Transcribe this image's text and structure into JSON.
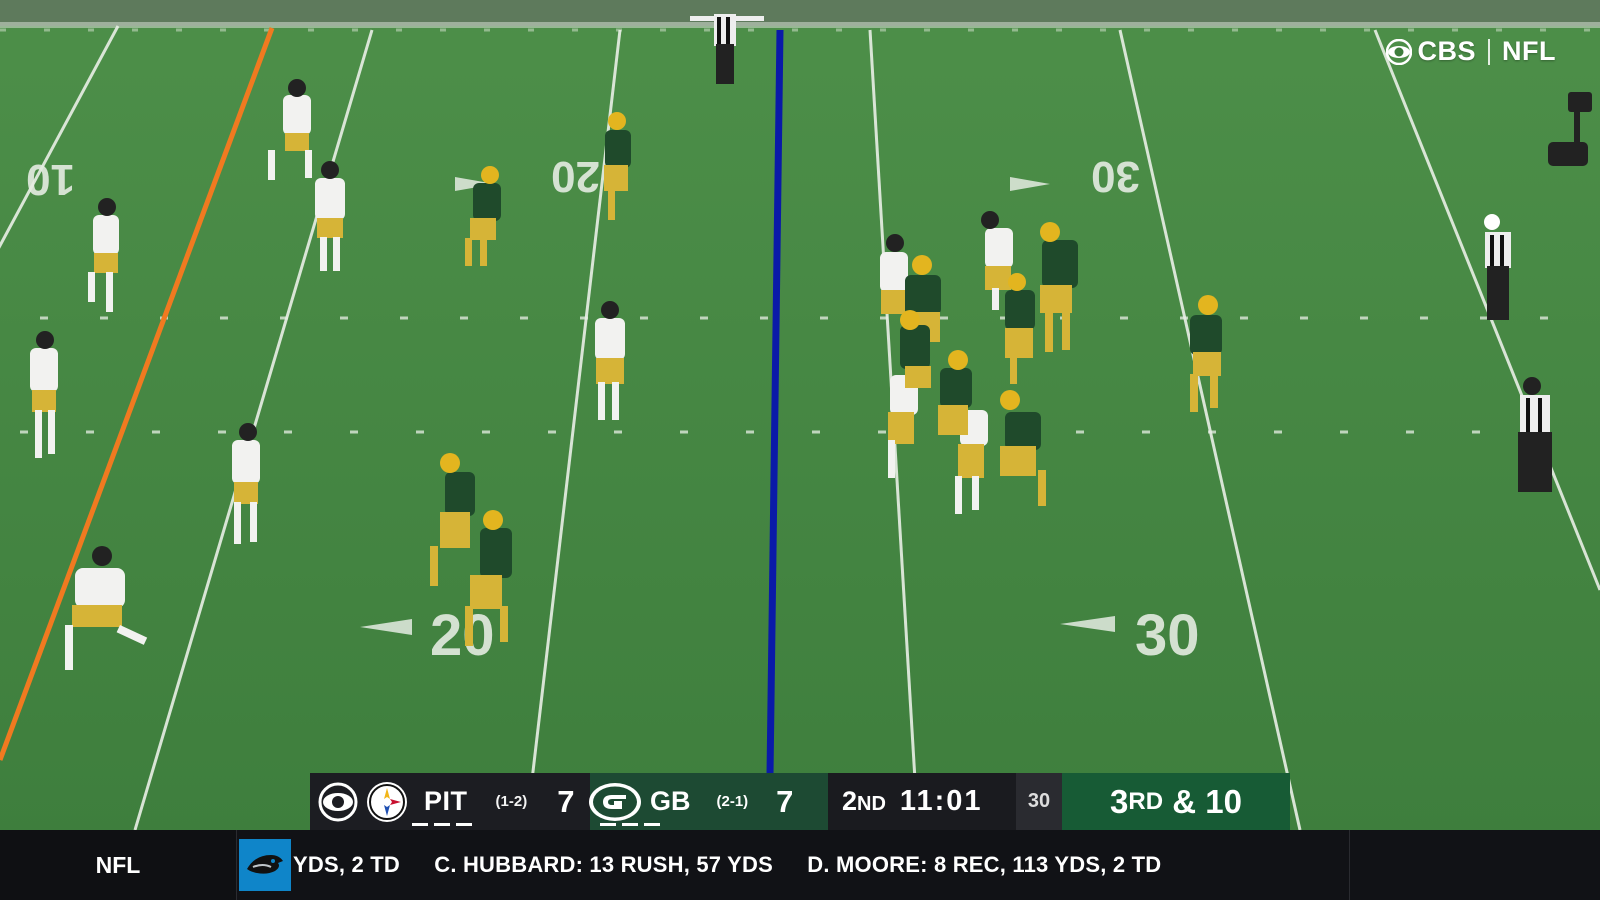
{
  "network": {
    "brand": "CBS",
    "league": "NFL",
    "eye_icon": "cbs-eye-icon"
  },
  "field": {
    "yard_numbers_top": [
      "10",
      "20",
      "30"
    ],
    "yard_numbers_bottom": [
      "20",
      "30"
    ],
    "first_down_line_color": "#f07a20",
    "line_of_scrimmage_color": "#0a1aa8"
  },
  "scorebug": {
    "away": {
      "abbr": "PIT",
      "record": "(1-2)",
      "score": "7",
      "logo": "steelers-logo",
      "color": "#1c1d22"
    },
    "home": {
      "abbr": "GB",
      "record": "(2-1)",
      "score": "7",
      "logo": "packers-logo",
      "color": "#1d4a33"
    },
    "quarter": "2",
    "quarter_suffix": "ND",
    "clock": "11:01",
    "play_clock": "30",
    "down": "3",
    "down_suffix": "RD",
    "distance": "& 10",
    "down_color": "#175b35"
  },
  "ticker": {
    "league": "NFL",
    "team_badge": "panthers-logo",
    "items": [
      "YDS, 2 TD",
      "C. HUBBARD: 13 RUSH, 57 YDS",
      "D. MOORE: 8 REC, 113 YDS, 2 TD"
    ]
  }
}
